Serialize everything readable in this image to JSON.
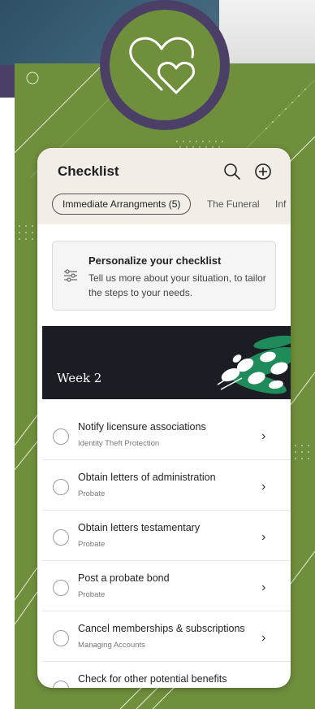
{
  "header": {
    "title": "Checklist"
  },
  "icons": {
    "search": "search-icon",
    "add": "plus-circle-icon",
    "badge": "hearts-icon",
    "filter": "sliders-icon",
    "chevron": "chevron-right-icon"
  },
  "tabs": [
    {
      "label": "Immediate Arrangments (5)",
      "active": true
    },
    {
      "label": "The Funeral",
      "active": false
    },
    {
      "label": "Inf",
      "active": false
    }
  ],
  "personalize": {
    "title": "Personalize your checklist",
    "description": "Tell us more about your situation, to tailor the steps to your needs."
  },
  "week": {
    "label": "Week 2"
  },
  "items": [
    {
      "title": "Notify licensure associations",
      "category": "Identity Theft Protection"
    },
    {
      "title": "Obtain letters of administration",
      "category": "Probate"
    },
    {
      "title": "Obtain letters testamentary",
      "category": "Probate"
    },
    {
      "title": "Post a probate bond",
      "category": "Probate"
    },
    {
      "title": "Cancel memberships & subscriptions",
      "category": "Managing Accounts"
    },
    {
      "title": "Check for other potential benefits",
      "category": ""
    }
  ],
  "colors": {
    "green": "#6f8f3c",
    "purple": "#4b3f68",
    "header_bg": "#f2ede6",
    "week_bg": "#1c1c24",
    "leaf": "#1f8a5a"
  }
}
